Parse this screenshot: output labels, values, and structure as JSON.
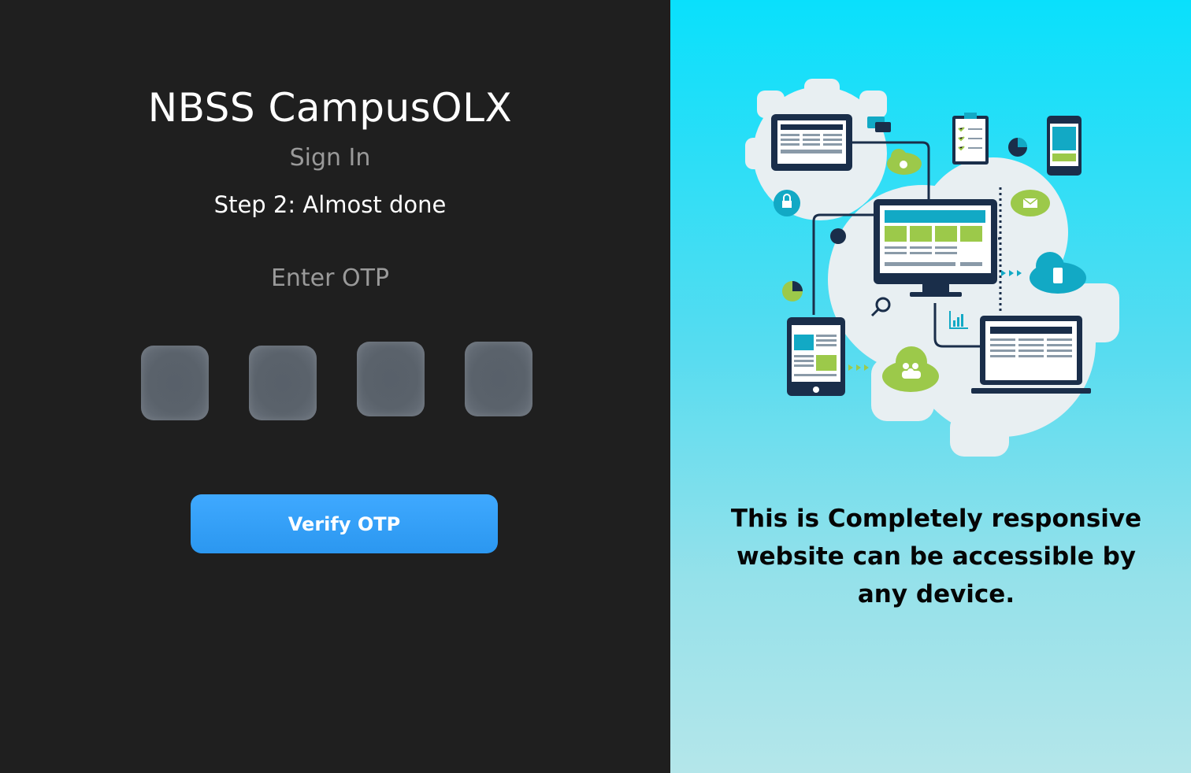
{
  "app": {
    "title": "NBSS CampusOLX"
  },
  "signin": {
    "heading": "Sign In",
    "step": "Step 2: Almost done",
    "otp_label": "Enter OTP",
    "otp_digits": [
      "",
      "",
      "",
      ""
    ],
    "verify_label": "Verify OTP"
  },
  "promo": {
    "tagline": "This is  Completely responsive website can be accessible by any device."
  },
  "colors": {
    "left_bg": "#1f1f1f",
    "accent_button": "#3fa9ff",
    "right_gradient_top": "#09e0fc",
    "right_gradient_bottom": "#b4e6ea",
    "illus_navy": "#1a2e4a",
    "illus_teal": "#12a9c5",
    "illus_green": "#9cc94a"
  }
}
